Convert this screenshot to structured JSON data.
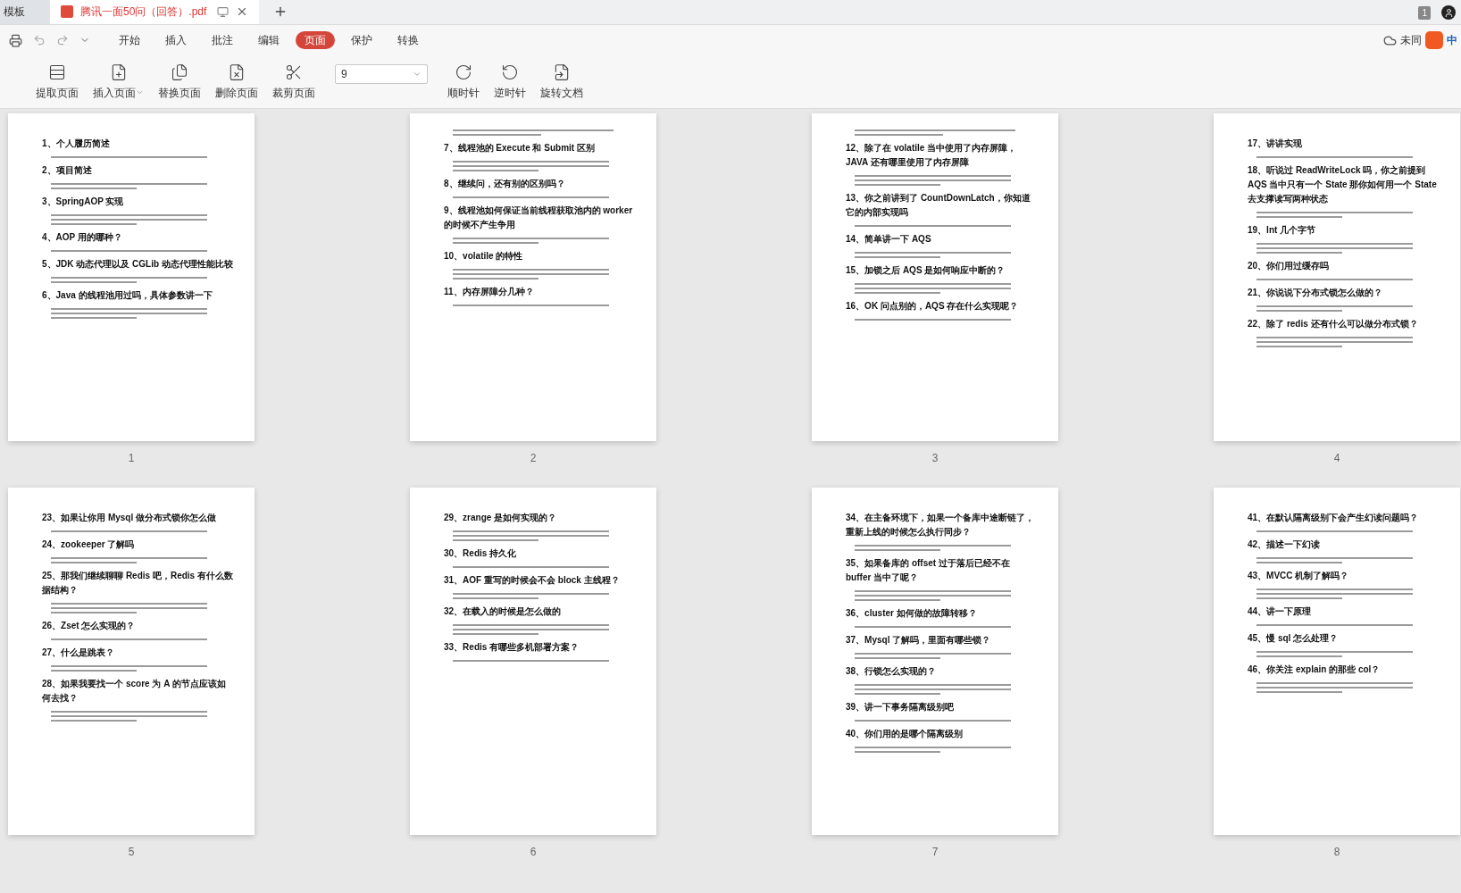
{
  "tabs": [
    {
      "label": "模板",
      "selected": false
    },
    {
      "label": "腾讯一面50问（回答）.pdf",
      "selected": true
    }
  ],
  "page_badge": "1",
  "menu": [
    {
      "label": "开始",
      "selected": false
    },
    {
      "label": "插入",
      "selected": false
    },
    {
      "label": "批注",
      "selected": false
    },
    {
      "label": "编辑",
      "selected": false
    },
    {
      "label": "页面",
      "selected": true
    },
    {
      "label": "保护",
      "selected": false
    },
    {
      "label": "转换",
      "selected": false
    }
  ],
  "sync_status": "未同",
  "ime": "中",
  "toolbar": [
    {
      "label": "提取页面",
      "kind": "button"
    },
    {
      "label": "插入页面",
      "kind": "dropdown"
    },
    {
      "label": "替换页面",
      "kind": "button"
    },
    {
      "label": "删除页面",
      "kind": "button"
    },
    {
      "label": "裁剪页面",
      "kind": "button"
    },
    {
      "value": "9",
      "kind": "field"
    },
    {
      "label": "顺时针",
      "kind": "button"
    },
    {
      "label": "逆时针",
      "kind": "button"
    },
    {
      "label": "旋转文档",
      "kind": "button"
    }
  ],
  "pages": [
    {
      "number": "1",
      "starts_with_text": false,
      "questions": [
        "1、个人履历简述",
        "2、项目简述",
        "3、SpringAOP 实现",
        "4、AOP 用的哪种？",
        "5、JDK 动态代理以及 CGLib 动态代理性能比较",
        "6、Java 的线程池用过吗，具体参数讲一下"
      ]
    },
    {
      "number": "2",
      "starts_with_text": true,
      "questions": [
        "7、线程池的 Execute 和 Submit 区别",
        "8、继续问，还有别的区别吗？",
        "9、线程池如何保证当前线程获取池内的 worker 的时候不产生争用",
        "10、volatile 的特性",
        "11、内存屏障分几种？"
      ]
    },
    {
      "number": "3",
      "starts_with_text": true,
      "questions": [
        "12、除了在 volatile 当中使用了内存屏障，JAVA 还有哪里使用了内存屏障",
        "13、你之前讲到了 CountDownLatch，你知道它的内部实现吗",
        "14、简单讲一下 AQS",
        "15、加锁之后 AQS 是如何响应中断的？",
        "16、OK 问点别的，AQS 存在什么实现呢？"
      ]
    },
    {
      "number": "4",
      "starts_with_text": false,
      "questions": [
        "17、讲讲实现",
        "18、听说过 ReadWriteLock 吗，你之前提到 AQS 当中只有一个 State 那你如何用一个 State 去支撑读写两种状态",
        "19、Int 几个字节",
        "20、你们用过缓存吗",
        "21、你说说下分布式锁怎么做的？",
        "22、除了 redis 还有什么可以做分布式锁？"
      ]
    },
    {
      "number": "5",
      "starts_with_text": false,
      "questions": [
        "23、如果让你用 Mysql 做分布式锁你怎么做",
        "24、zookeeper 了解吗",
        "25、那我们继续聊聊 Redis 吧，Redis 有什么数据结构？",
        "26、Zset 怎么实现的？",
        "27、什么是跳表？",
        "28、如果我要找一个 score 为 A 的节点应该如何去找？"
      ]
    },
    {
      "number": "6",
      "starts_with_text": false,
      "questions": [
        "29、zrange 是如何实现的？",
        "30、Redis 持久化",
        "31、AOF 重写的时候会不会 block 主线程？",
        "32、在载入的时候是怎么做的",
        "33、Redis 有哪些多机部署方案？"
      ]
    },
    {
      "number": "7",
      "starts_with_text": false,
      "questions": [
        "34、在主备环境下，如果一个备库中途断链了，重新上线的时候怎么执行同步？",
        "35、如果备库的 offset 过于落后已经不在 buffer 当中了呢？",
        "36、cluster 如何做的故障转移？",
        "37、Mysql 了解吗，里面有哪些锁？",
        "38、行锁怎么实现的？",
        "39、讲一下事务隔离级别吧",
        "40、你们用的是哪个隔离级别"
      ]
    },
    {
      "number": "8",
      "starts_with_text": false,
      "questions": [
        "41、在默认隔离级别下会产生幻读问题吗？",
        "42、描述一下幻读",
        "43、MVCC 机制了解吗？",
        "44、讲一下原理",
        "45、慢 sql 怎么处理？",
        "46、你关注 explain 的那些 col？"
      ]
    }
  ]
}
